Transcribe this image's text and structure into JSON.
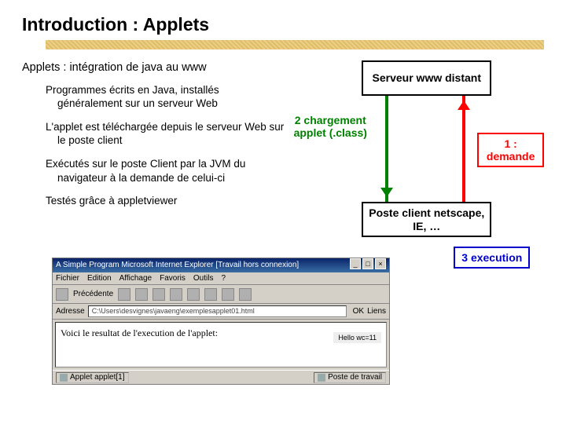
{
  "title": "Introduction : Applets",
  "subtitle": "Applets : intégration de java au www",
  "bullets": [
    "Programmes écrits en Java, installés généralement sur un serveur Web",
    "L'applet est téléchargée depuis le serveur Web sur le poste client",
    "Exécutés sur le poste Client par la JVM du navigateur à la demande de celui-ci",
    "Testés grâce à appletviewer"
  ],
  "diagram": {
    "server": "Serveur www distant",
    "load": "2 chargement applet (.class)",
    "demande": "1 : demande",
    "client": "Poste client netscape, IE, …",
    "exec": "3 execution"
  },
  "ie": {
    "title": "A Simple Program   Microsoft Internet Explorer   [Travail hors connexion]",
    "menu": [
      "Fichier",
      "Edition",
      "Affichage",
      "Favoris",
      "Outils",
      "?"
    ],
    "back": "Précédente",
    "addr_label": "Adresse",
    "addr_value": "C:\\Users\\desvignes\\javaeng\\exemplesapplet01.html",
    "ok": "OK",
    "links": "Liens",
    "content_text": "Voici le resultat de l'execution de l'applet:",
    "applet_out": "Hello wc=11",
    "status_left": "Applet applet[1]",
    "status_right": "Poste de travail"
  }
}
